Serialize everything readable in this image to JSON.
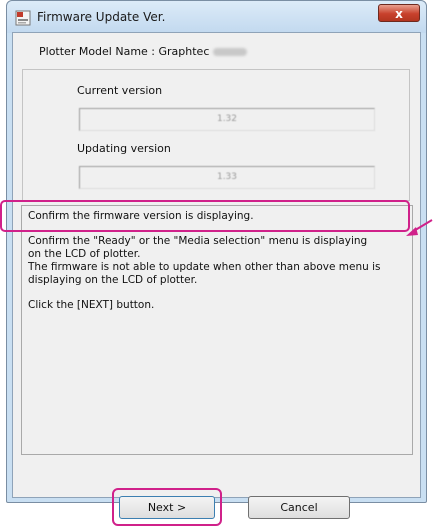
{
  "window": {
    "title": "Firmware Update Ver.",
    "close_label": "x"
  },
  "model": {
    "label": "Plotter Model Name : Graphtec"
  },
  "versions": {
    "current_label": "Current version",
    "current_value": "1.32",
    "updating_label": "Updating version",
    "updating_value": "1.33"
  },
  "message": {
    "line1": "Confirm the firmware version is displaying.",
    "line2": "Confirm the \"Ready\" or the \"Media selection\" menu is displaying",
    "line3": "on the LCD of plotter.",
    "line4": "The firmware is not able to update when other than above menu is",
    "line5": "displaying on the LCD of plotter.",
    "line6": "Click the [NEXT] button."
  },
  "buttons": {
    "next_label": "Next >",
    "cancel_label": "Cancel"
  },
  "colors": {
    "highlight": "#d0218a",
    "titlebar": "#c9dff2",
    "close_button": "#c8412c"
  }
}
